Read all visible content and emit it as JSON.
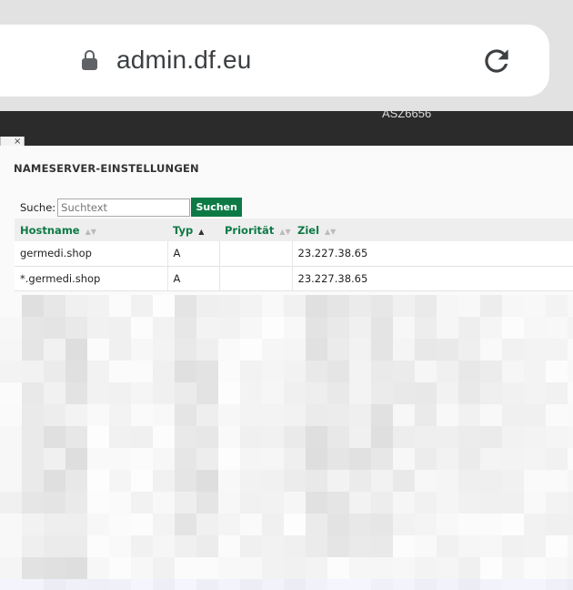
{
  "browser": {
    "url": "admin.df.eu",
    "icons": [
      "lock-icon",
      "reload-icon"
    ]
  },
  "site_header": {
    "items": [
      "ASZ6656"
    ]
  },
  "tab": {
    "close_glyph": "×"
  },
  "panel": {
    "title": "NAMESERVER-EINSTELLUNGEN",
    "search": {
      "label": "Suche:",
      "placeholder": "Suchtext",
      "button": "Suchen"
    },
    "table": {
      "headers": [
        "Hostname",
        "Typ",
        "Priorität",
        "Ziel"
      ],
      "rows": [
        [
          "germedi.shop",
          "A",
          "",
          "23.227.38.65"
        ],
        [
          "*.germedi.shop",
          "A",
          "",
          "23.227.38.65"
        ]
      ]
    }
  },
  "colors": {
    "accent": "#0d7a45",
    "header_bg": "#2b2b2b"
  }
}
